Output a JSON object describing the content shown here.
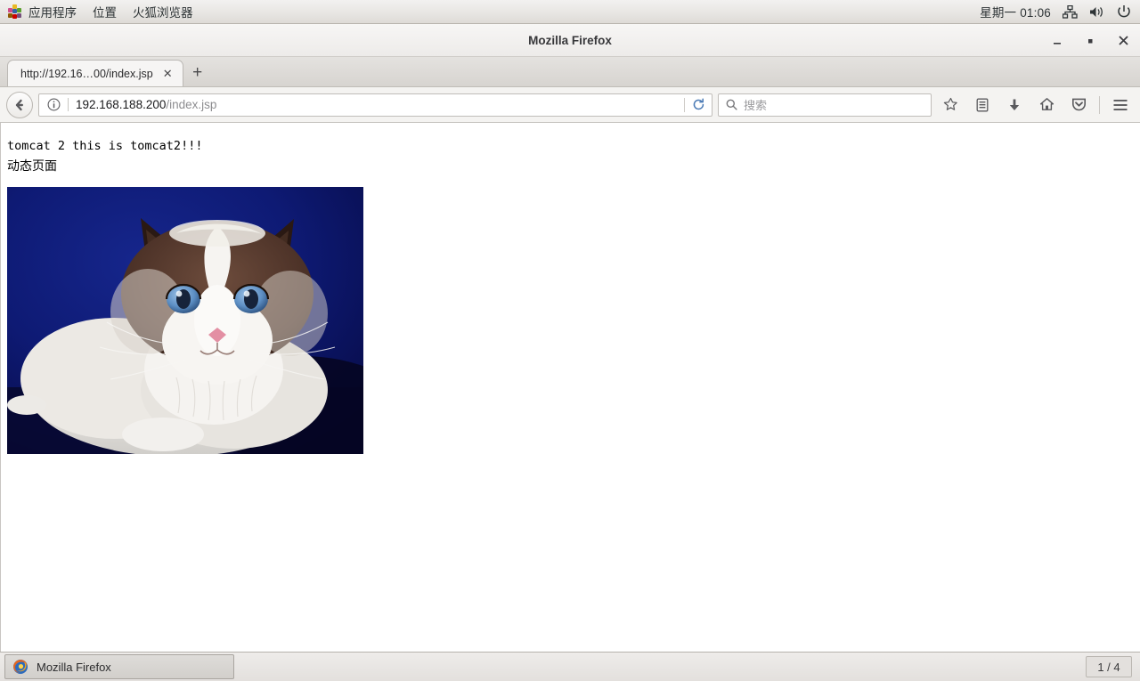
{
  "desktop_panel": {
    "menus": [
      {
        "label": "应用程序",
        "icon": "applications-icon"
      },
      {
        "label": "位置",
        "icon": null
      },
      {
        "label": "火狐浏览器",
        "icon": null
      }
    ],
    "clock": "星期一 01:06",
    "tray_icons": [
      "network-icon",
      "volume-icon",
      "power-icon"
    ]
  },
  "browser": {
    "window_title": "Mozilla Firefox",
    "window_controls": {
      "minimize": "−",
      "maximize": "▫",
      "close": "✕"
    },
    "tabs": [
      {
        "title": "http://192.16…00/index.jsp",
        "close_label": "✕",
        "active": true
      }
    ],
    "new_tab_label": "+",
    "toolbar": {
      "back_label": "◀",
      "identity_icon": "info-icon",
      "url_host": "192.168.188.200",
      "url_path": "/index.jsp",
      "reload_icon": "reload-icon",
      "search_placeholder": "搜索",
      "icons": [
        {
          "name": "bookmark-star-icon"
        },
        {
          "name": "library-icon"
        },
        {
          "name": "downloads-icon"
        },
        {
          "name": "home-icon"
        },
        {
          "name": "pocket-icon"
        },
        {
          "name": "menu-hamburger-icon"
        }
      ]
    }
  },
  "page": {
    "line1": "tomcat 2 this is tomcat2!!!",
    "line2": "动态页面",
    "image_alt": "ragdoll-cat-photo",
    "image_background": "#0d1a6b"
  },
  "taskbar": {
    "window_button_label": "Mozilla Firefox",
    "window_button_icon": "firefox-icon",
    "workspace": "1 / 4"
  }
}
